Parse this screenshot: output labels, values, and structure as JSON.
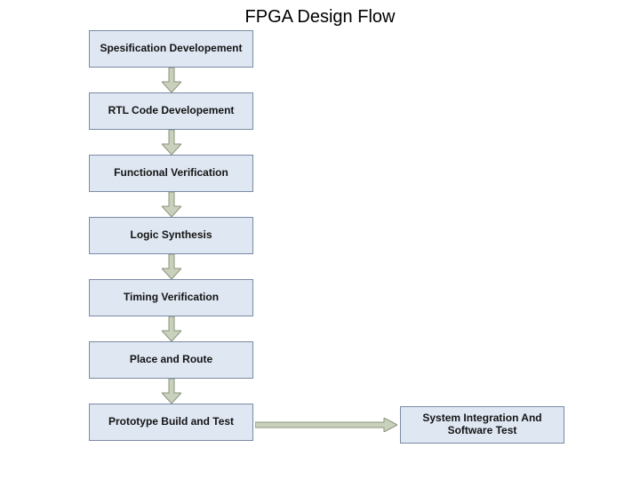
{
  "title": "FPGA Design Flow",
  "steps": [
    "Spesification Developement",
    "RTL Code Developement",
    "Functional Verification",
    "Logic Synthesis",
    "Timing Verification",
    "Place and Route",
    "Prototype Build and Test"
  ],
  "side_step": "System Integration And Software Test",
  "colors": {
    "box_fill": "#dfe7f2",
    "box_border": "#7a8aa6",
    "arrow_fill": "#c9d1bd",
    "arrow_stroke": "#8a947a"
  }
}
